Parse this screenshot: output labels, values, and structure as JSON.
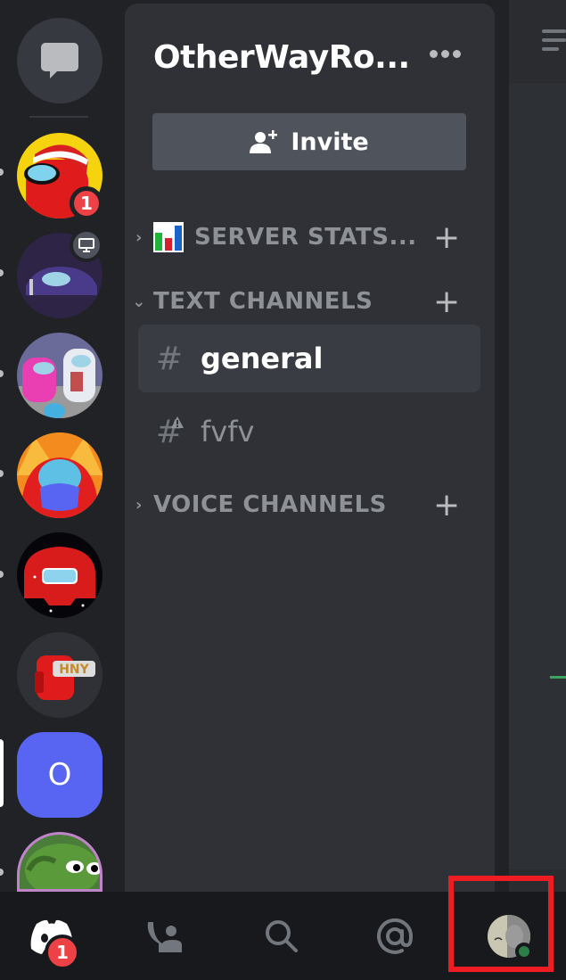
{
  "colors": {
    "accent": "#5865f2",
    "mention_badge": "#ed4245",
    "online_status": "#3ba55d",
    "highlight_box": "#ee1d23"
  },
  "rail": {
    "dm_button": {
      "icon": "chat-bubble-icon"
    },
    "servers": [
      {
        "name": "among-us-santa",
        "unread": true,
        "mentions": "1"
      },
      {
        "name": "among-us-purple",
        "unread": true,
        "status_icon": "screen-share-icon"
      },
      {
        "name": "among-us-pink-white",
        "unread": true
      },
      {
        "name": "among-us-discord",
        "unread": true
      },
      {
        "name": "among-us-red-space",
        "unread": true
      },
      {
        "name": "among-us-hny",
        "unread": false
      },
      {
        "name": "O",
        "initial": "O",
        "selected": true
      },
      {
        "name": "pepe",
        "unread": true
      }
    ]
  },
  "server": {
    "name": "OtherWayRo...",
    "invite_label": "Invite",
    "categories": [
      {
        "label": "SERVER STATS...",
        "emoji": "bar-chart",
        "collapsed": true
      },
      {
        "label": "TEXT CHANNELS",
        "collapsed": false
      },
      {
        "label": "VOICE CHANNELS",
        "collapsed": true
      }
    ],
    "channels": [
      {
        "name": "general",
        "type": "text",
        "active": true
      },
      {
        "name": "fvfv",
        "type": "text-restricted",
        "active": false
      }
    ]
  },
  "nav": {
    "home_mentions": "1",
    "items": [
      "home",
      "friends",
      "search",
      "mentions",
      "profile"
    ],
    "profile_status": "online"
  }
}
